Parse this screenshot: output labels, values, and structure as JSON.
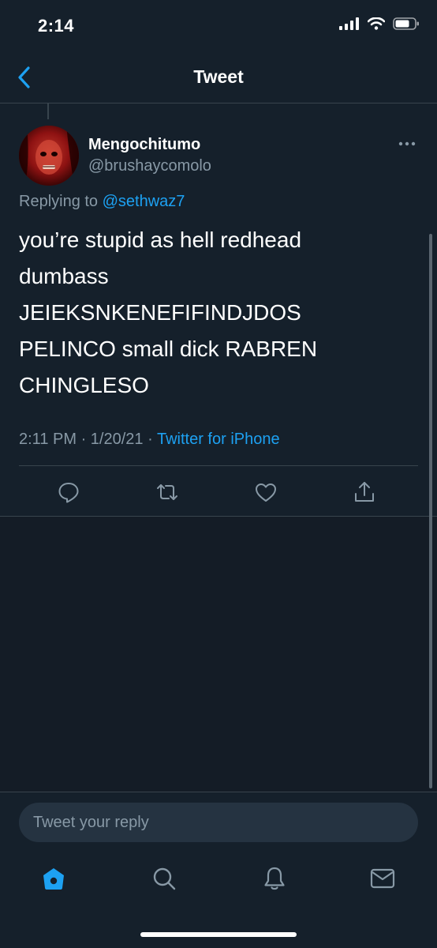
{
  "status_bar": {
    "time": "2:14"
  },
  "nav": {
    "title": "Tweet"
  },
  "tweet": {
    "display_name": "Mengochitumo",
    "handle": "@brushaycomolo",
    "replying_prefix": "Replying to",
    "replying_to": "@sethwaz7",
    "text": "you’re stupid as hell redhead\ndumbass\nJEIEKSNKENEFIFINDJDOS\nPELINCO  small dick RABREN\nCHINGLESO",
    "time": "2:11 PM",
    "date": "1/20/21",
    "separator": "·",
    "source": "Twitter for iPhone"
  },
  "reply": {
    "placeholder": "Tweet your reply"
  },
  "icons": {
    "back": "chevron-left-icon",
    "more": "more-dots-icon",
    "reply": "comment-icon",
    "retweet": "retweet-icon",
    "like": "heart-icon",
    "share": "share-icon",
    "home": "home-icon",
    "search": "search-icon",
    "notifications": "bell-icon",
    "messages": "mail-icon"
  },
  "colors": {
    "background": "#15202b",
    "accent": "#1da1f2",
    "secondary_text": "#8899a6",
    "divider": "#38444d"
  }
}
